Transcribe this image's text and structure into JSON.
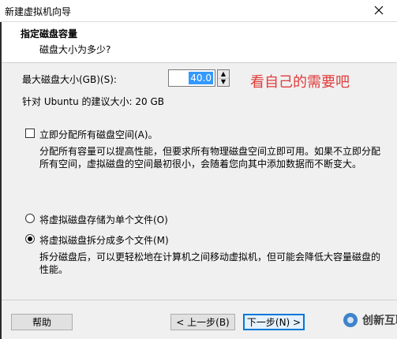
{
  "window": {
    "title": "新建虚拟机向导",
    "close_icon": "close-icon"
  },
  "header": {
    "title": "指定磁盘容量",
    "subtitle": "磁盘大小为多少?"
  },
  "main": {
    "max_disk_label": "最大磁盘大小(GB)(S):",
    "max_disk_value": "40.0",
    "annotation": "看自己的需要吧",
    "recommended_text": "针对 Ubuntu 的建议大小: 20 GB",
    "allocate_now_label": "立即分配所有磁盘空间(A)。",
    "allocate_desc_line1": "分配所有容量可以提高性能，但要求所有物理磁盘空间立即可用。如果不立即分配",
    "allocate_desc_line2": "所有空间，虚拟磁盘的空间最初很小，会随着您向其中添加数据而不断变大。",
    "single_file_label": "将虚拟磁盘存储为单个文件(O)",
    "multi_file_label": "将虚拟磁盘拆分成多个文件(M)",
    "multi_desc_line1": "拆分磁盘后，可以更轻松地在计算机之间移动虚拟机，但可能会降低大容量磁盘的",
    "multi_desc_line2": "性能。",
    "allocate_now_checked": false,
    "storage_selected": "multi"
  },
  "buttons": {
    "help": "帮助",
    "back": "< 上一步(B)",
    "next": "下一步(N) >"
  },
  "watermark": {
    "text": "创新互联"
  },
  "colors": {
    "annotation": "#e23b3b",
    "primary_border": "#0078d7",
    "selection": "#3399ff"
  }
}
